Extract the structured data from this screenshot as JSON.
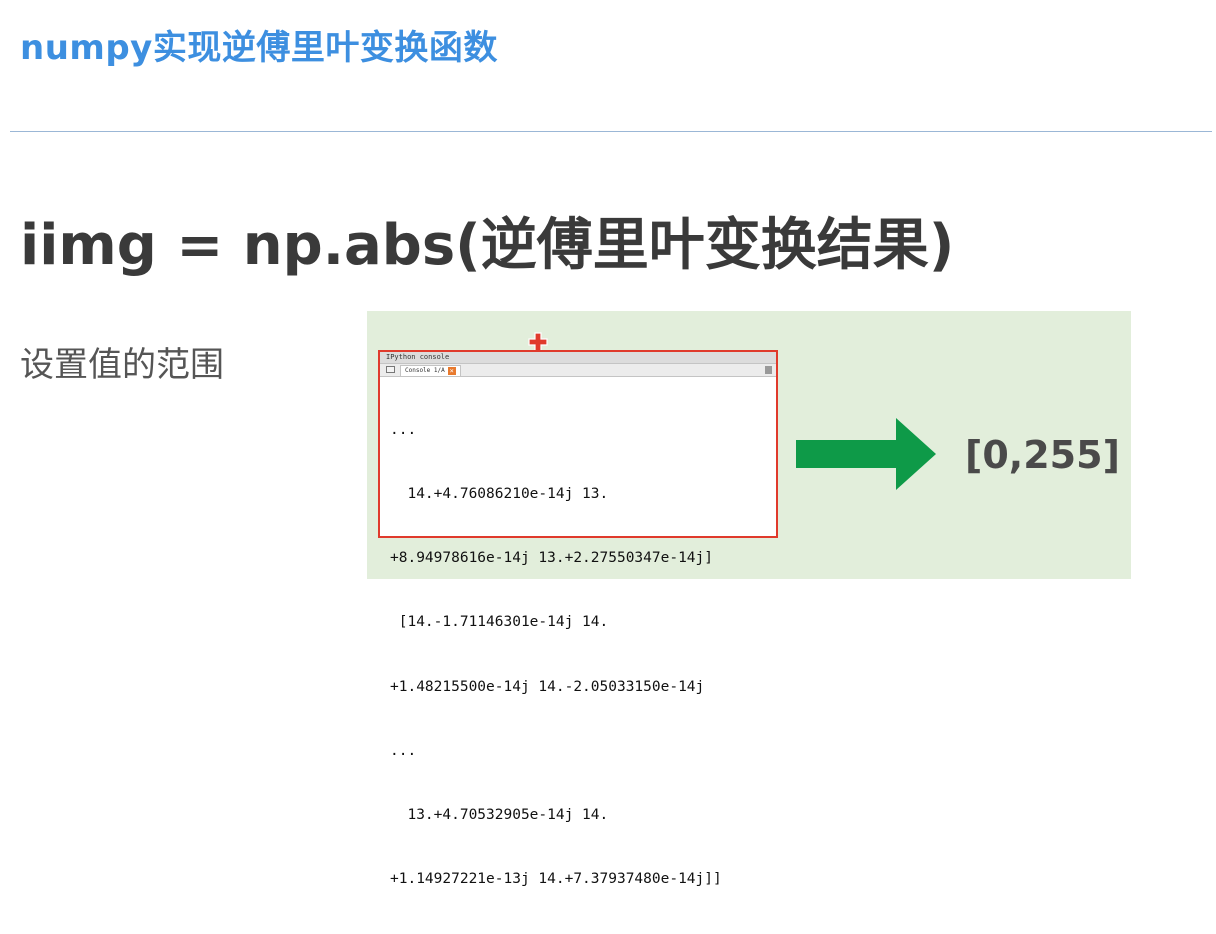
{
  "header": {
    "title": "numpy实现逆傅里叶变换函数"
  },
  "main": {
    "formula": "iimg = np.abs(逆傅里叶变换结果)",
    "subtitle": "设置值的范围",
    "result_range": "[0,255]"
  },
  "console": {
    "window_title": "IPython console",
    "tab_label": "Console 1/A",
    "lines": [
      "...",
      "  14.+4.76086210e-14j 13.",
      "+8.94978616e-14j 13.+2.27550347e-14j]",
      " [14.-1.71146301e-14j 14.",
      "+1.48215500e-14j 14.-2.05033150e-14j",
      "...",
      "  13.+4.70532905e-14j 14.",
      "+1.14927221e-13j 14.+7.37937480e-14j]]"
    ]
  },
  "colors": {
    "title_blue": "#3d8fe0",
    "panel_bg": "#e2eedb",
    "arrow_green": "#0e9a48",
    "highlight_red": "#e03a2c"
  },
  "icons": [
    "cursor-cross-icon",
    "folder-icon",
    "tab-close-icon",
    "right-arrow-icon"
  ]
}
